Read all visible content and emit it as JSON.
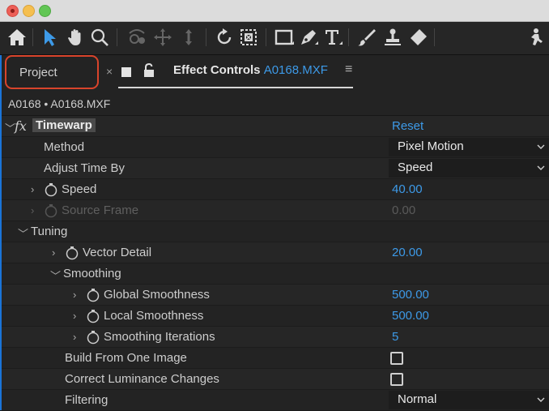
{
  "tabs": {
    "project_label": "Project",
    "close_glyph": "×",
    "effect_controls_label": "Effect Controls",
    "effect_controls_clip": "A0168.MXF",
    "menu_glyph": "≡"
  },
  "clip_path": "A0168 • A0168.MXF",
  "effect": {
    "name": "Timewarp",
    "fx_glyph": "fx",
    "reset_label": "Reset"
  },
  "properties": [
    {
      "label": "Method",
      "value": "Pixel Motion",
      "kind": "dropdown"
    },
    {
      "label": "Adjust Time By",
      "value": "Speed",
      "kind": "dropdown"
    },
    {
      "label": "Speed",
      "value": "40.00",
      "kind": "number"
    },
    {
      "label": "Source Frame",
      "value": "0.00",
      "kind": "number-disabled"
    },
    {
      "label": "Tuning",
      "kind": "group"
    },
    {
      "label": "Vector Detail",
      "value": "20.00",
      "kind": "number"
    },
    {
      "label": "Smoothing",
      "kind": "group"
    },
    {
      "label": "Global Smoothness",
      "value": "500.00",
      "kind": "number"
    },
    {
      "label": "Local Smoothness",
      "value": "500.00",
      "kind": "number"
    },
    {
      "label": "Smoothing Iterations",
      "value": "5",
      "kind": "number"
    },
    {
      "label": "Build From One Image",
      "checked": false,
      "kind": "checkbox"
    },
    {
      "label": "Correct Luminance Changes",
      "checked": false,
      "kind": "checkbox"
    },
    {
      "label": "Filtering",
      "value": "Normal",
      "kind": "dropdown"
    }
  ],
  "toolbar_icons": [
    "home-icon",
    "selection-tool-icon",
    "hand-tool-icon",
    "zoom-tool-icon",
    "orbit-camera-icon",
    "pan-camera-icon",
    "dolly-camera-icon",
    "rotation-tool-icon",
    "pan-behind-tool-icon",
    "rectangle-tool-icon",
    "pen-tool-icon",
    "type-tool-icon",
    "brush-tool-icon",
    "clone-stamp-tool-icon",
    "eraser-tool-icon",
    "puppet-tool-icon"
  ],
  "colors": {
    "accent_blue": "#3d9ae8",
    "highlight_red": "#d9442b"
  }
}
